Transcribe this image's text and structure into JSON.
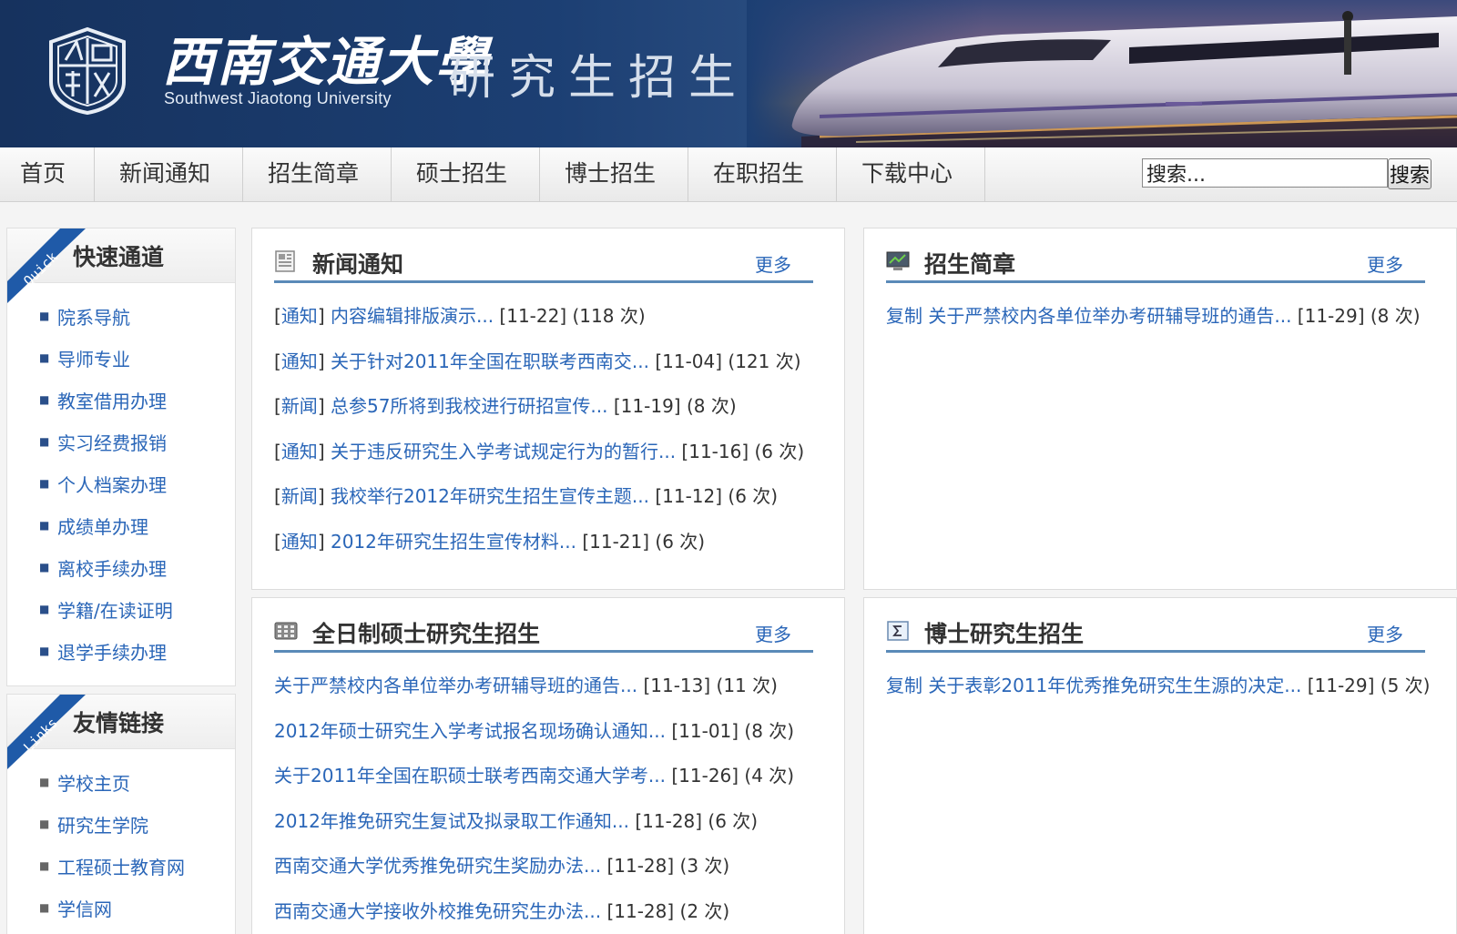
{
  "banner": {
    "logo_cn": "西南交通大學",
    "logo_en": "Southwest Jiaotong University",
    "title": "研究生招生",
    "seal_icon": "university-seal-icon",
    "train_icon": "high-speed-train-icon"
  },
  "nav": {
    "items": [
      "首页",
      "新闻通知",
      "招生简章",
      "硕士招生",
      "博士招生",
      "在职招生",
      "下载中心"
    ],
    "search_placeholder": "搜索...",
    "search_value": "搜索...",
    "search_button": "搜索"
  },
  "sidebar": {
    "quick": {
      "ribbon": "Quick",
      "title": "快速通道",
      "items": [
        "院系导航",
        "导师专业",
        "教室借用办理",
        "实习经费报销",
        "个人档案办理",
        "成绩单办理",
        "离校手续办理",
        "学籍/在读证明",
        "退学手续办理"
      ]
    },
    "links": {
      "ribbon": "Links",
      "title": "友情链接",
      "items": [
        "学校主页",
        "研究生学院",
        "工程硕士教育网",
        "学信网"
      ]
    }
  },
  "panels": {
    "news": {
      "title": "新闻通知",
      "more": "更多",
      "items": [
        {
          "cat": "通知",
          "title": "内容编辑排版演示...",
          "meta": "[11-22] (118 次)"
        },
        {
          "cat": "通知",
          "title": "关于针对2011年全国在职联考西南交...",
          "meta": "[11-04] (121 次)"
        },
        {
          "cat": "新闻",
          "title": "总参57所将到我校进行研招宣传...",
          "meta": "[11-19] (8 次)"
        },
        {
          "cat": "通知",
          "title": "关于违反研究生入学考试规定行为的暂行...",
          "meta": "[11-16] (6 次)"
        },
        {
          "cat": "新闻",
          "title": "我校举行2012年研究生招生宣传主题...",
          "meta": "[11-12] (6 次)"
        },
        {
          "cat": "通知",
          "title": "2012年研究生招生宣传材料...",
          "meta": "[11-21] (6 次)"
        }
      ]
    },
    "guide": {
      "title": "招生简章",
      "more": "更多",
      "items": [
        {
          "title": "复制 关于严禁校内各单位举办考研辅导班的通告...",
          "meta": "[11-29] (8 次)"
        }
      ]
    },
    "master": {
      "title": "全日制硕士研究生招生",
      "more": "更多",
      "items": [
        {
          "title": "关于严禁校内各单位举办考研辅导班的通告...",
          "meta": "[11-13] (11 次)"
        },
        {
          "title": "2012年硕士研究生入学考试报名现场确认通知...",
          "meta": "[11-01] (8 次)"
        },
        {
          "title": "关于2011年全国在职硕士联考西南交通大学考...",
          "meta": "[11-26] (4 次)"
        },
        {
          "title": "2012年推免研究生复试及拟录取工作通知...",
          "meta": "[11-28] (6 次)"
        },
        {
          "title": "西南交通大学优秀推免研究生奖励办法...",
          "meta": "[11-28] (3 次)"
        },
        {
          "title": "西南交通大学接收外校推免研究生办法...",
          "meta": "[11-28] (2 次)"
        }
      ]
    },
    "phd": {
      "title": "博士研究生招生",
      "more": "更多",
      "items": [
        {
          "title": "复制 关于表彰2011年优秀推免研究生生源的决定...",
          "meta": "[11-29] (5 次)"
        }
      ]
    }
  }
}
